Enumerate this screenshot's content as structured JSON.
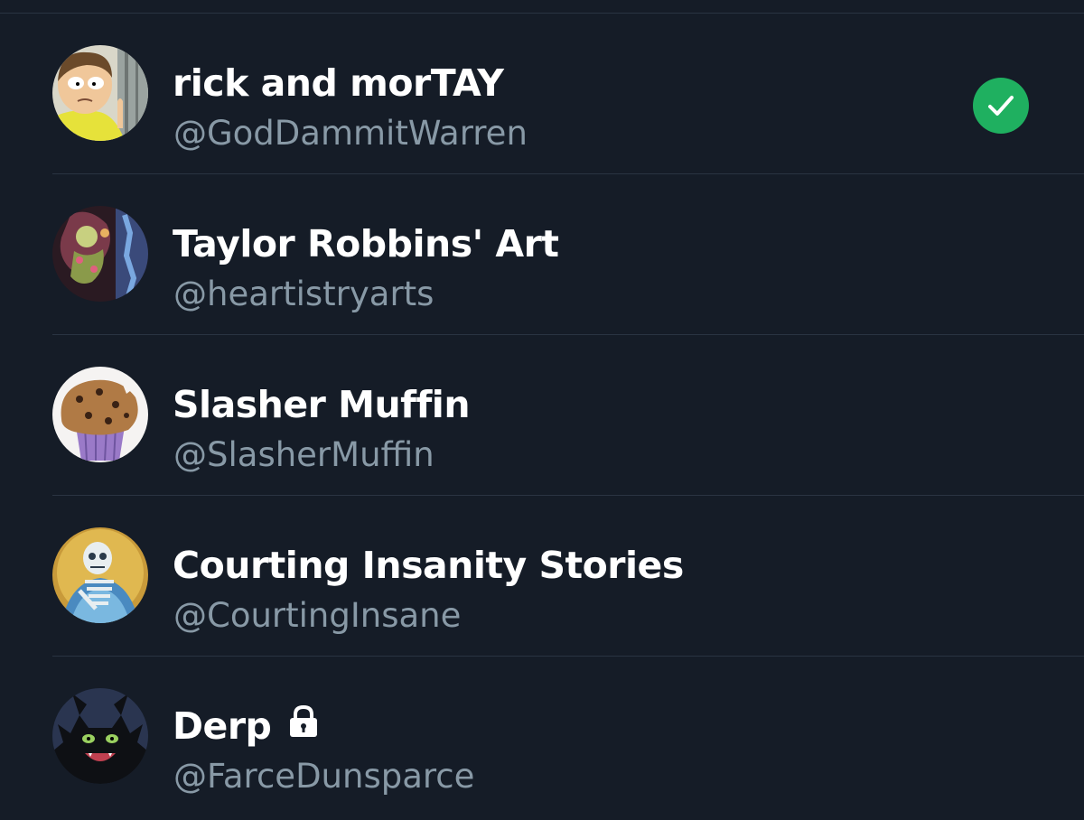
{
  "colors": {
    "background": "#151c27",
    "divider": "#2a3442",
    "name_text": "#ffffff",
    "handle_text": "#8899a6",
    "check_green": "#1fb060"
  },
  "accounts": [
    {
      "name": "rick and morTAY",
      "handle": "@GodDammitWarren",
      "selected": true,
      "locked": false,
      "avatar_icon": "morty-avatar"
    },
    {
      "name": "Taylor Robbins' Art",
      "handle": "@heartistryarts",
      "selected": false,
      "locked": false,
      "avatar_icon": "art-avatar"
    },
    {
      "name": "Slasher Muffin",
      "handle": "@SlasherMuffin",
      "selected": false,
      "locked": false,
      "avatar_icon": "muffin-avatar"
    },
    {
      "name": "Courting Insanity Stories",
      "handle": "@CourtingInsane",
      "selected": false,
      "locked": false,
      "avatar_icon": "skeleton-avatar"
    },
    {
      "name": "Derp",
      "handle": "@FarceDunsparce",
      "selected": false,
      "locked": true,
      "avatar_icon": "dragon-avatar"
    }
  ]
}
